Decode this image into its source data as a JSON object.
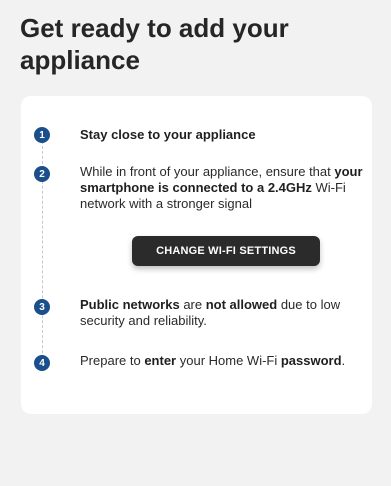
{
  "page": {
    "title": "Get ready to add your appliance"
  },
  "steps": [
    {
      "number": "1",
      "parts": [
        {
          "text": "Stay close to your appliance",
          "bold": true
        }
      ]
    },
    {
      "number": "2",
      "parts": [
        {
          "text": "While in front of your appliance, ensure that ",
          "bold": false
        },
        {
          "text": "your smartphone is connected to a 2.4GHz",
          "bold": true
        },
        {
          "text": " Wi-Fi network with a stronger signal",
          "bold": false
        }
      ]
    },
    {
      "number": "3",
      "parts": [
        {
          "text": "Public networks",
          "bold": true
        },
        {
          "text": " are ",
          "bold": false
        },
        {
          "text": "not allowed",
          "bold": true
        },
        {
          "text": " due to low security and reliability.",
          "bold": false
        }
      ]
    },
    {
      "number": "4",
      "parts": [
        {
          "text": "Prepare to ",
          "bold": false
        },
        {
          "text": "enter",
          "bold": true
        },
        {
          "text": " your Home Wi-Fi ",
          "bold": false
        },
        {
          "text": "password",
          "bold": true
        },
        {
          "text": ".",
          "bold": false
        }
      ]
    }
  ],
  "change_wifi_button": {
    "label": "CHANGE WI-FI SETTINGS"
  },
  "colors": {
    "step_badge": "#1a4f8c",
    "button_bg": "#2b2b2b",
    "page_bg": "#f2f2f2",
    "card_bg": "#ffffff"
  }
}
